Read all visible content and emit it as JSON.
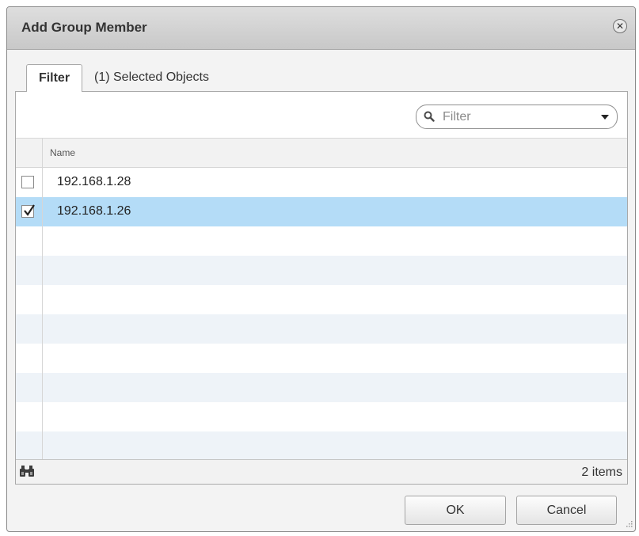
{
  "dialog": {
    "title": "Add Group Member",
    "close_icon": "close-icon"
  },
  "tabs": [
    {
      "label": "Filter",
      "active": true
    },
    {
      "label": "(1) Selected Objects",
      "active": false
    }
  ],
  "filter": {
    "placeholder": "Filter",
    "search_icon": "search-icon",
    "dropdown_icon": "chevron-down-icon"
  },
  "grid": {
    "columns": [
      {
        "label": "Name"
      }
    ],
    "rows": [
      {
        "name": "192.168.1.28",
        "checked": false,
        "selected": false
      },
      {
        "name": "192.168.1.26",
        "checked": true,
        "selected": true
      }
    ],
    "footer": {
      "icon": "binoculars-icon",
      "count_label": "2 items"
    }
  },
  "buttons": {
    "ok": "OK",
    "cancel": "Cancel"
  },
  "colors": {
    "selected_row": "#b4dcf7",
    "alt_row": "#eef3f8",
    "titlebar": "#d2d2d2"
  }
}
